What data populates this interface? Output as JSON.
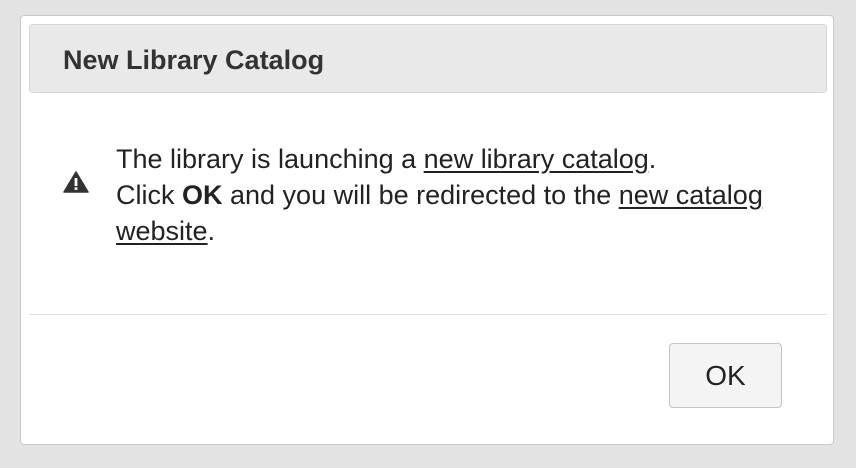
{
  "dialog": {
    "title": "New Library Catalog",
    "icon": "warning-triangle-icon",
    "message": {
      "text_1": "The library is launching a ",
      "link_1": "new library catalog",
      "text_2": ".",
      "text_3": "Click ",
      "bold_ok": "OK",
      "text_4": " and you will be redirected to the ",
      "link_2": "new catalog website",
      "text_5": "."
    },
    "ok_label": "OK"
  }
}
